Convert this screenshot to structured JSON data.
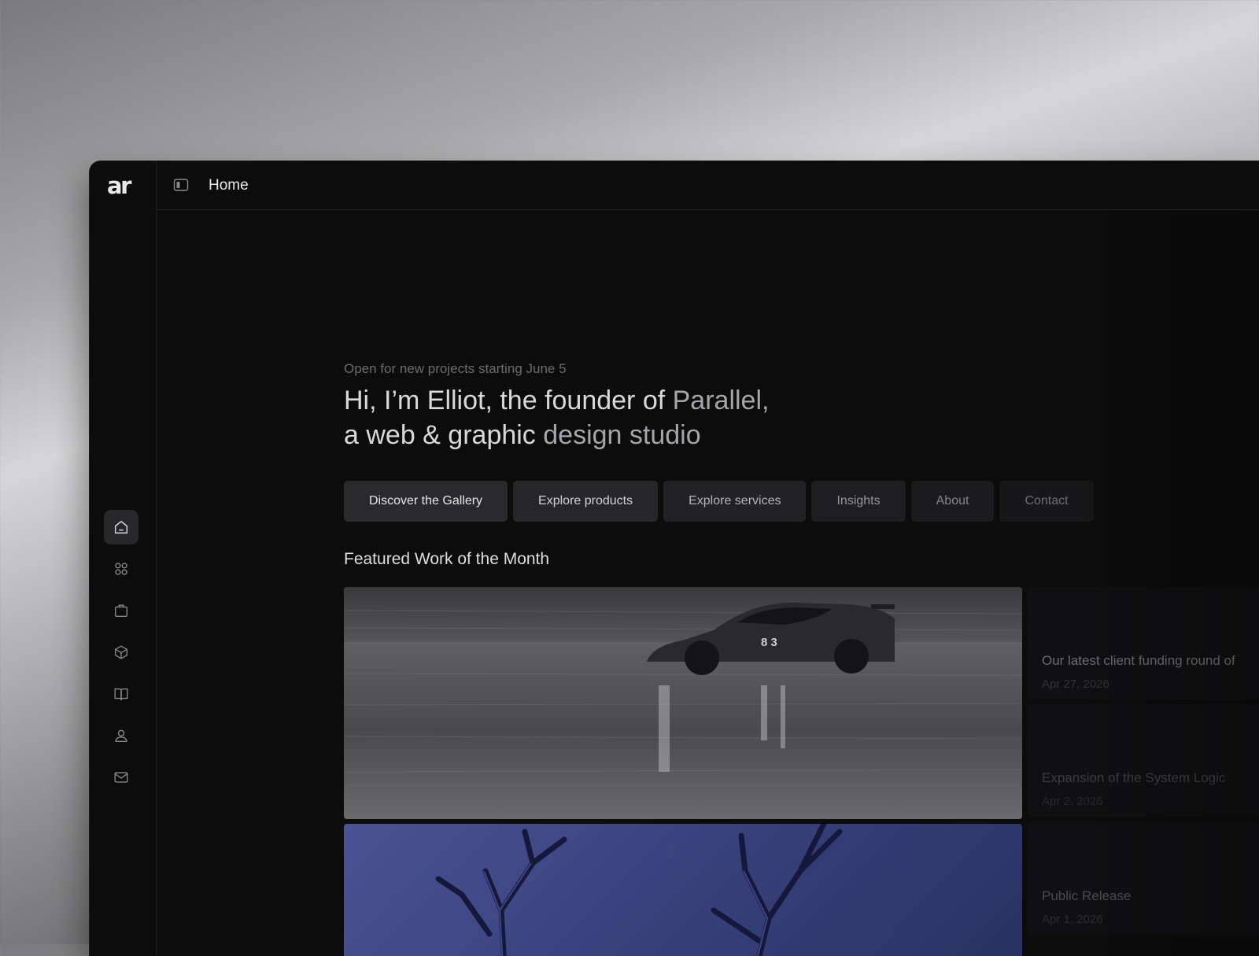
{
  "app": {
    "logo": "ar"
  },
  "sidebar": {
    "items": [
      {
        "icon": "home-icon",
        "active": true
      },
      {
        "icon": "grid-icon",
        "active": false
      },
      {
        "icon": "briefcase-icon",
        "active": false
      },
      {
        "icon": "box-icon",
        "active": false
      },
      {
        "icon": "book-icon",
        "active": false
      },
      {
        "icon": "user-icon",
        "active": false
      },
      {
        "icon": "mail-icon",
        "active": false
      }
    ]
  },
  "header": {
    "breadcrumb": "Home",
    "toggle_icon": "sidebar-toggle-icon"
  },
  "hero": {
    "tagline": "Open for new projects starting June 5",
    "headline_line1_bright": "Hi, I’m Elliot, the founder of",
    "headline_line1_dim": " Parallel,",
    "headline_line2_bright": "a web & graphic",
    "headline_line2_dim": " design studio"
  },
  "buttons": [
    {
      "label": "Discover the Gallery"
    },
    {
      "label": "Explore products"
    },
    {
      "label": "Explore services"
    },
    {
      "label": "Insights"
    },
    {
      "label": "About"
    },
    {
      "label": "Contact"
    }
  ],
  "featured": {
    "title": "Featured Work of the Month",
    "works": [
      {
        "image": "race-car-on-wet-track"
      },
      {
        "image": "bare-tree-branches-on-blue"
      }
    ]
  },
  "news": [
    {
      "title": "Our latest client funding round of",
      "date": "Apr 27, 2026"
    },
    {
      "title": "Expansion of the System Logic",
      "date": "Apr 2, 2026"
    },
    {
      "title": "Public Release",
      "date": "Apr 1, 2026"
    }
  ],
  "colors": {
    "background": "#0c0c0d",
    "accent_blue": "#4a5294"
  }
}
